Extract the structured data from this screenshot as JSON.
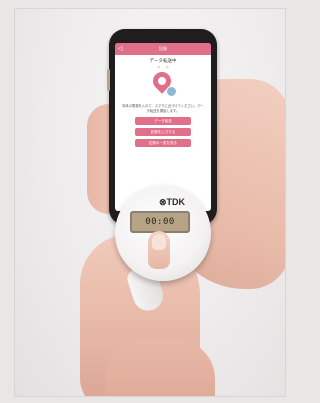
{
  "photo": {
    "description_tags": []
  },
  "app": {
    "header_title": "記録",
    "back_glyph": "◁",
    "screen_title": "データ転送中",
    "sub_items": [
      "◎",
      "◎"
    ],
    "instruction": "本体の電源を入れて、スマホに近づけてください。データ転送を開始します。",
    "buttons": [
      "データ転送",
      "記録を入力する",
      "記録の一覧を見る"
    ]
  },
  "device": {
    "logo": "⊗TDK",
    "display": "00:00"
  }
}
